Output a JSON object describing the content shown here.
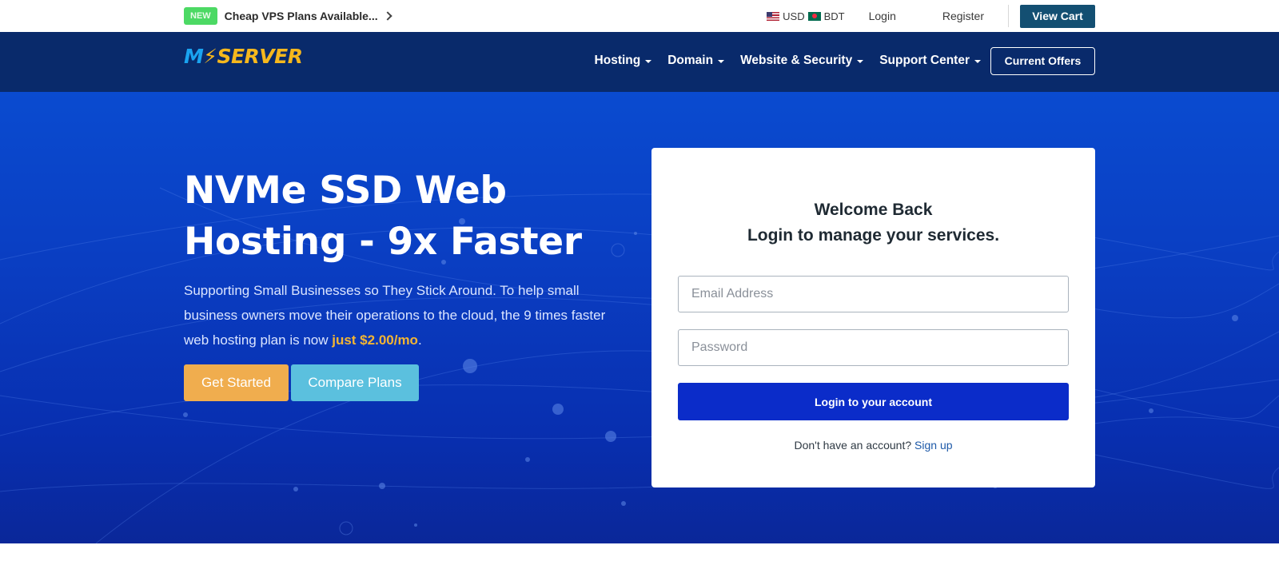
{
  "topbar": {
    "badge": "NEW",
    "promo": "Cheap VPS Plans Available...",
    "currency_usd": "USD",
    "currency_bdt": "BDT",
    "login": "Login",
    "register": "Register",
    "view_cart": "View Cart"
  },
  "nav": {
    "logo_prefix": "M",
    "logo_suffix": "SERVER",
    "items": [
      {
        "label": "Hosting"
      },
      {
        "label": "Domain"
      },
      {
        "label": "Website & Security"
      },
      {
        "label": "Support Center"
      }
    ],
    "offers": "Current Offers"
  },
  "hero": {
    "title": "NVMe SSD Web Hosting - 9x Faster",
    "text": "Supporting Small Businesses so They Stick Around. To help small business owners move their operations to the cloud, the 9 times faster web hosting plan is now ",
    "price": "just $2.00/mo",
    "text_end": ".",
    "get_started": "Get Started",
    "compare_plans": "Compare Plans"
  },
  "login": {
    "title": "Welcome Back",
    "subtitle": "Login to manage your services.",
    "email_placeholder": "Email Address",
    "password_placeholder": "Password",
    "submit": "Login to your account",
    "no_account": "Don't have an account?",
    "signup": "Sign up"
  },
  "colors": {
    "topbar_bg": "#ffffff",
    "navbar_bg": "#092a6b",
    "hero_bg": "#0a3dc1",
    "cart_button": "#134f72",
    "get_started": "#f0ad4e",
    "compare_plans": "#5bc0de",
    "login_button": "#0b2cc9",
    "price_accent": "#f3b533",
    "new_badge": "#4cd964"
  }
}
